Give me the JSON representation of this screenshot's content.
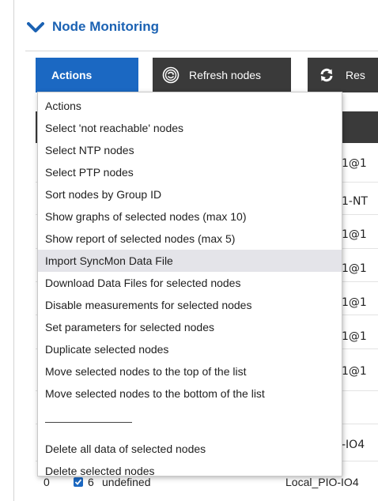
{
  "section": {
    "title": "Node Monitoring",
    "icon": "chevron-down-icon"
  },
  "toolbar": {
    "actions_label": "Actions",
    "refresh_label": "Refresh nodes",
    "reset_label": "Res",
    "refresh_icon": "refresh-nodes-icon",
    "reset_icon": "reset-arrows-icon"
  },
  "background_table": {
    "cells": [
      "1@1",
      "1-NT",
      "1@1",
      "1@1",
      "1@1",
      "1@1",
      "1@1"
    ],
    "partial_rows": [
      "-IO4",
      "-IO4"
    ],
    "bottom_row": {
      "index": "0",
      "number": "6",
      "state": "undefined",
      "location": "Local_PIO-IO4"
    }
  },
  "menu": {
    "items": [
      "Actions",
      "Select 'not reachable' nodes",
      "Select NTP nodes",
      "Select PTP nodes",
      "Sort nodes by Group ID",
      "Show graphs of selected nodes (max 10)",
      "Show report of selected nodes (max 5)",
      "Import SyncMon Data File",
      "Download Data Files for selected nodes",
      "Disable measurements for selected nodes",
      "Set parameters for selected nodes",
      "Duplicate selected nodes",
      "Move selected nodes to the top of the list",
      "Move selected nodes to the bottom of the list"
    ],
    "after_separator": [
      "Delete all data of selected nodes",
      "Delete selected nodes"
    ],
    "highlighted_index": 7,
    "highlight_color": "#e4e4e9"
  },
  "colors": {
    "accent": "#1b68c2",
    "dark_button": "#3a3a3a",
    "header_text": "#1b62b3"
  }
}
